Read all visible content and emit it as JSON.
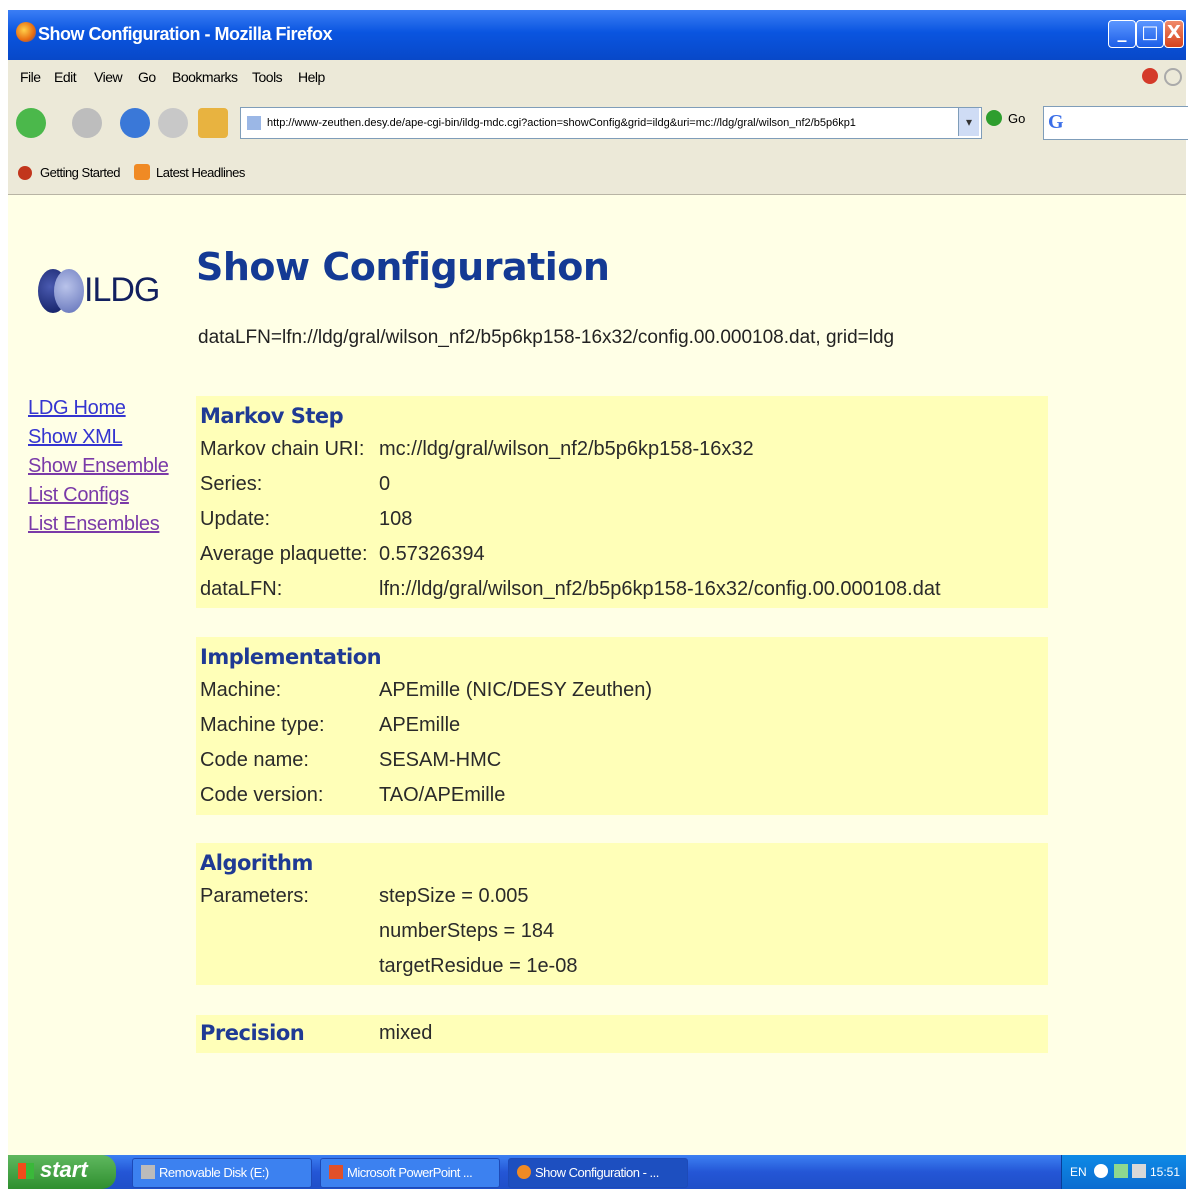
{
  "window": {
    "title": "Show Configuration - Mozilla Firefox",
    "controls": {
      "minimize": "_",
      "maximize": "□",
      "close": "X"
    }
  },
  "menubar": [
    "File",
    "Edit",
    "View",
    "Go",
    "Bookmarks",
    "Tools",
    "Help"
  ],
  "navigation": {
    "url": "http://www-zeuthen.desy.de/ape-cgi-bin/ildg-mdc.cgi?action=showConfig&grid=ildg&uri=mc://ldg/gral/wilson_nf2/b5p6kp1",
    "go_label": "Go",
    "search_placeholder": "G"
  },
  "bookmarks": [
    "Getting Started",
    "Latest Headlines"
  ],
  "page": {
    "logo_text": "ILDG",
    "title": "Show Configuration",
    "lfn_line": "dataLFN=lfn://ldg/gral/wilson_nf2/b5p6kp158-16x32/config.00.000108.dat, grid=ldg",
    "sidebar_links": [
      "LDG Home",
      "Show XML",
      "Show Ensemble",
      "List Configs",
      "List Ensembles"
    ],
    "markov": {
      "heading": "Markov Step",
      "rows": [
        {
          "key": "Markov chain URI:",
          "value": "mc://ldg/gral/wilson_nf2/b5p6kp158-16x32"
        },
        {
          "key": "Series:",
          "value": "0"
        },
        {
          "key": "Update:",
          "value": "108"
        },
        {
          "key": "Average plaquette:",
          "value": "0.57326394"
        },
        {
          "key": "dataLFN:",
          "value": "lfn://ldg/gral/wilson_nf2/b5p6kp158-16x32/config.00.000108.dat"
        }
      ]
    },
    "implementation": {
      "heading": "Implementation",
      "rows": [
        {
          "key": "Machine:",
          "value": "APEmille (NIC/DESY Zeuthen)"
        },
        {
          "key": "Machine type:",
          "value": "APEmille"
        },
        {
          "key": "Code name:",
          "value": "SESAM-HMC"
        },
        {
          "key": "Code version:",
          "value": "TAO/APEmille"
        }
      ]
    },
    "algorithm": {
      "heading": "Algorithm",
      "param_key": "Parameters:",
      "params": [
        "stepSize = 0.005",
        "numberSteps = 184",
        "targetResidue = 1e-08"
      ]
    },
    "precision": {
      "heading": "Precision",
      "value": "mixed"
    }
  },
  "taskbar": {
    "start": "start",
    "tasks": [
      "Removable Disk (E:)",
      "Microsoft PowerPoint ...",
      "Show Configuration - ..."
    ],
    "lang": "EN",
    "clock": "15:51"
  },
  "colors": {
    "page_bg": "#ffffe6",
    "section_bg": "#ffffb8",
    "heading": "#1f3a94",
    "link": "#3535d0",
    "visited_link": "#7a3aa8"
  }
}
